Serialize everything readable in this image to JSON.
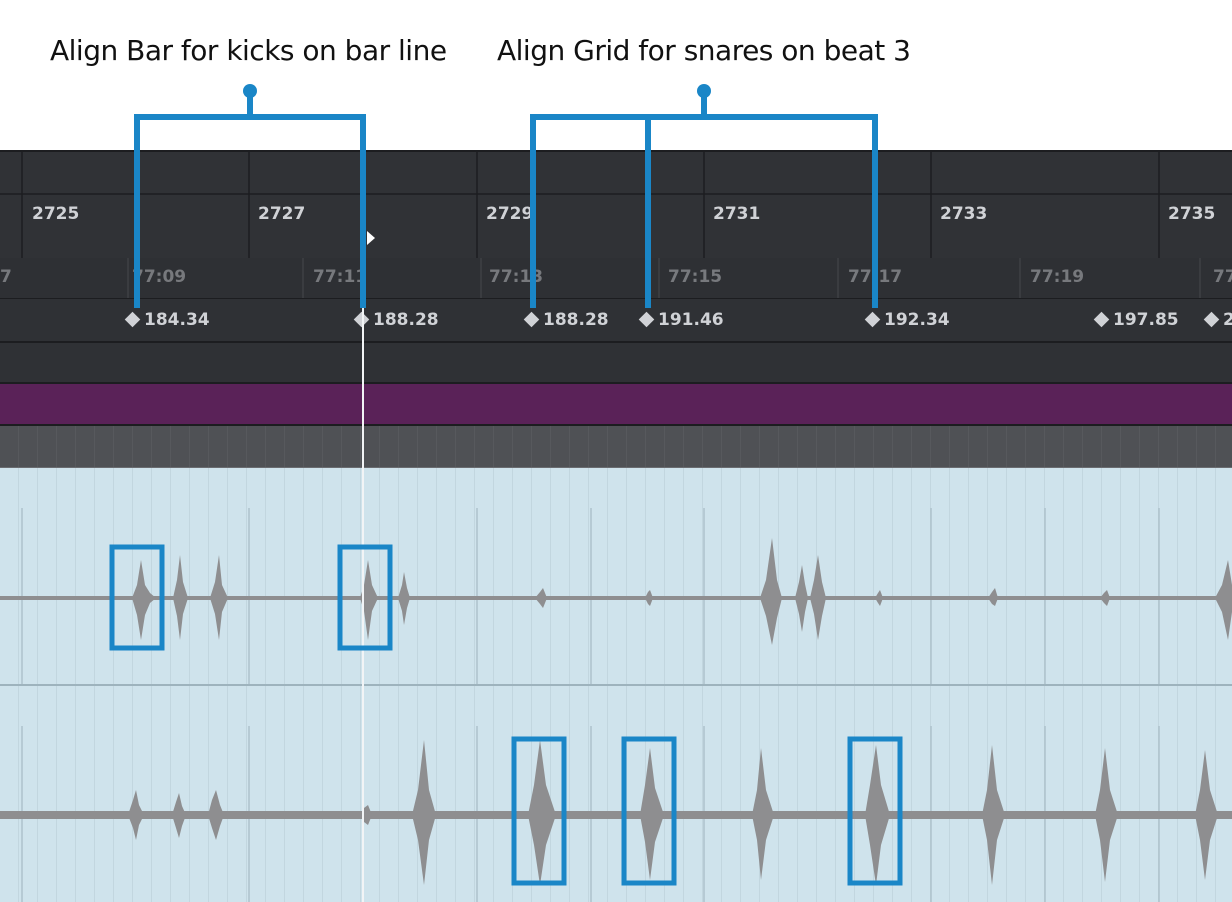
{
  "captions": {
    "left": "Align Bar for kicks on bar line",
    "right": "Align Grid for snares on beat 3"
  },
  "ruler": {
    "bars": [
      "2725",
      "2727",
      "2729",
      "2731",
      "2733",
      "2735"
    ],
    "times": [
      "7",
      "77:09",
      "77:11",
      "77:13",
      "77:15",
      "77:17",
      "77:19",
      "77"
    ]
  },
  "tempo_markers": [
    "184.34",
    "188.28",
    "188.28",
    "191.46",
    "192.34",
    "197.85",
    "2"
  ],
  "colors": {
    "callout": "#1a86c7",
    "waveform": "#8e8e90",
    "track_bg": "#cfe3ec",
    "purple_lane": "#5a2258"
  }
}
